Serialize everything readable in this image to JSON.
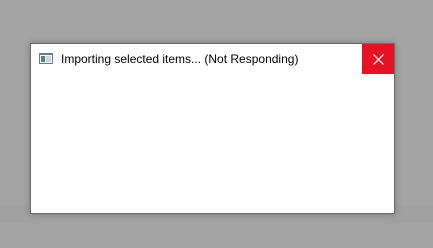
{
  "dialog": {
    "title": "Importing selected items... (Not Responding)",
    "app_icon": "window-app-icon",
    "close_icon": "close-icon",
    "close_color": "#e81123"
  }
}
